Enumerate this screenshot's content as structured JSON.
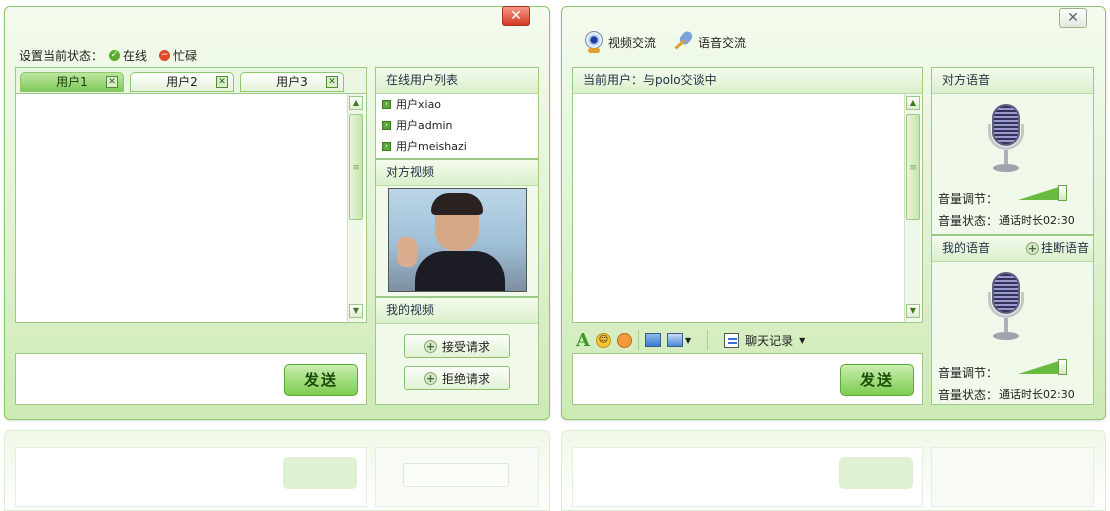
{
  "left_window": {
    "status_label": "设置当前状态：",
    "status_online": "在线",
    "status_busy": "忙碌",
    "tabs": [
      {
        "label": "用户1"
      },
      {
        "label": "用户2"
      },
      {
        "label": "用户3"
      }
    ],
    "send_label": "发送",
    "online_list_title": "在线用户列表",
    "online_users": [
      {
        "name": "用户xiao"
      },
      {
        "name": "用户admin"
      },
      {
        "name": "用户meishazi"
      }
    ],
    "peer_video_title": "对方视频",
    "my_video_title": "我的视频",
    "accept_label": "接受请求",
    "reject_label": "拒绝请求"
  },
  "right_window": {
    "video_chat_label": "视频交流",
    "voice_chat_label": "语音交流",
    "current_user_label": "当前用户：与polo交谈中",
    "chat_history_label": "聊天记录",
    "send_label": "发送",
    "peer_voice_title": "对方语音",
    "my_voice_title": "我的语音",
    "hangup_label": "挂断语音",
    "volume_label": "音量调节：",
    "status_label": "音量状态：",
    "peer_status_value": "通话时长02:30",
    "my_status_value": "通话时长02:30"
  },
  "colors": {
    "online": "#5aad2e",
    "busy": "#e04a2a",
    "accent": "#7ccd50"
  },
  "icons": [
    "close-icon",
    "online-status-icon",
    "busy-status-icon",
    "tab-close-icon",
    "webcam-icon",
    "microphone-icon",
    "font-icon",
    "emoticon-icon",
    "image-icon",
    "screenshot-icon",
    "chat-history-icon",
    "add-icon"
  ]
}
